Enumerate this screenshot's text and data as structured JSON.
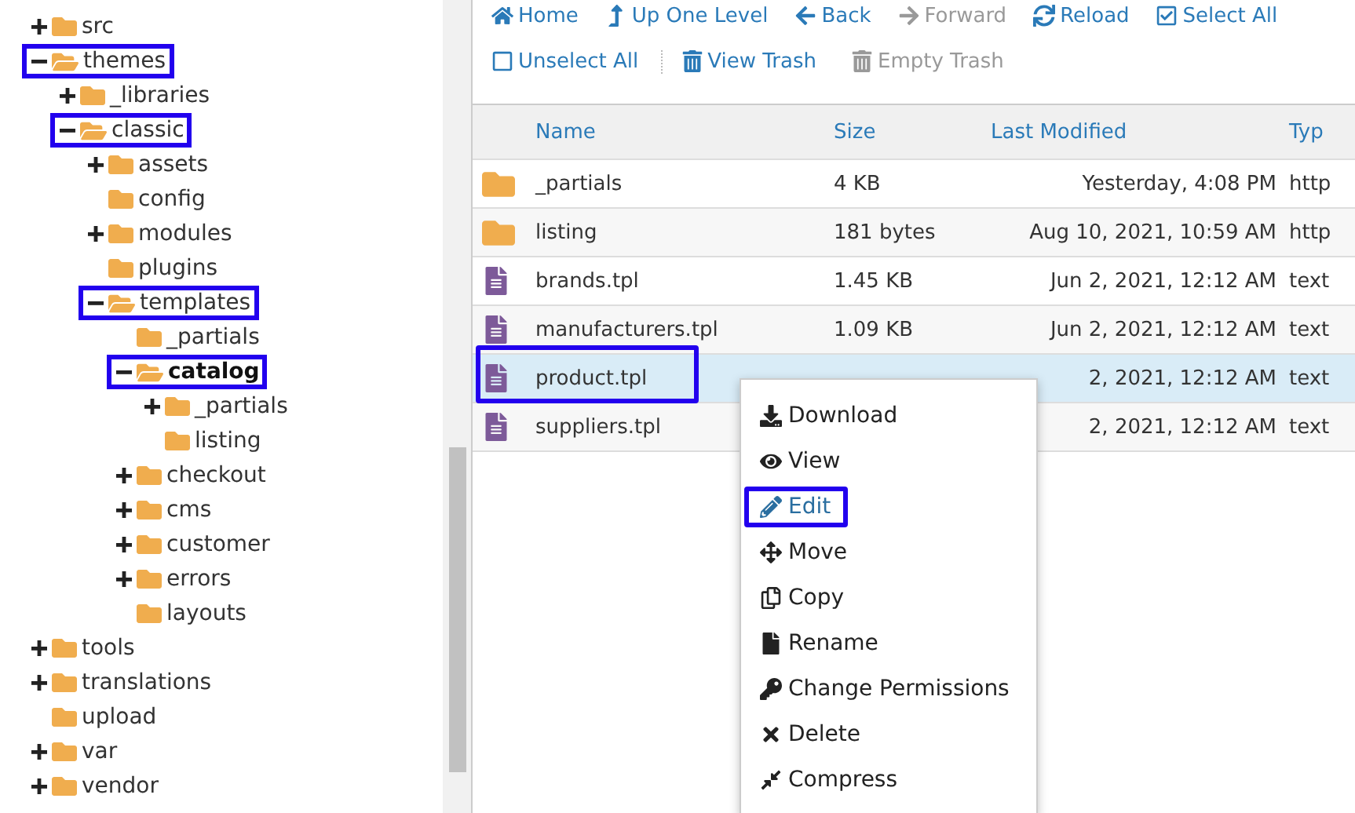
{
  "tree": [
    {
      "label": "src",
      "expanded": false,
      "has_children": true,
      "highlighted": false,
      "selected": false
    },
    {
      "label": "themes",
      "expanded": true,
      "has_children": true,
      "highlighted": true,
      "selected": false,
      "children": [
        {
          "label": "_libraries",
          "expanded": false,
          "has_children": true,
          "highlighted": false,
          "selected": false
        },
        {
          "label": "classic",
          "expanded": true,
          "has_children": true,
          "highlighted": true,
          "selected": false,
          "children": [
            {
              "label": "assets",
              "expanded": false,
              "has_children": true,
              "highlighted": false,
              "selected": false
            },
            {
              "label": "config",
              "expanded": false,
              "has_children": false,
              "highlighted": false,
              "selected": false
            },
            {
              "label": "modules",
              "expanded": false,
              "has_children": true,
              "highlighted": false,
              "selected": false
            },
            {
              "label": "plugins",
              "expanded": false,
              "has_children": false,
              "highlighted": false,
              "selected": false
            },
            {
              "label": "templates",
              "expanded": true,
              "has_children": true,
              "highlighted": true,
              "selected": false,
              "children": [
                {
                  "label": "_partials",
                  "expanded": false,
                  "has_children": false,
                  "highlighted": false,
                  "selected": false
                },
                {
                  "label": "catalog",
                  "expanded": true,
                  "has_children": true,
                  "highlighted": true,
                  "selected": true,
                  "children": [
                    {
                      "label": "_partials",
                      "expanded": false,
                      "has_children": true,
                      "highlighted": false,
                      "selected": false
                    },
                    {
                      "label": "listing",
                      "expanded": false,
                      "has_children": false,
                      "highlighted": false,
                      "selected": false
                    }
                  ]
                },
                {
                  "label": "checkout",
                  "expanded": false,
                  "has_children": true,
                  "highlighted": false,
                  "selected": false
                },
                {
                  "label": "cms",
                  "expanded": false,
                  "has_children": true,
                  "highlighted": false,
                  "selected": false
                },
                {
                  "label": "customer",
                  "expanded": false,
                  "has_children": true,
                  "highlighted": false,
                  "selected": false
                },
                {
                  "label": "errors",
                  "expanded": false,
                  "has_children": true,
                  "highlighted": false,
                  "selected": false
                },
                {
                  "label": "layouts",
                  "expanded": false,
                  "has_children": false,
                  "highlighted": false,
                  "selected": false
                }
              ]
            }
          ]
        }
      ]
    },
    {
      "label": "tools",
      "expanded": false,
      "has_children": true,
      "highlighted": false,
      "selected": false
    },
    {
      "label": "translations",
      "expanded": false,
      "has_children": true,
      "highlighted": false,
      "selected": false
    },
    {
      "label": "upload",
      "expanded": false,
      "has_children": false,
      "highlighted": false,
      "selected": false
    },
    {
      "label": "var",
      "expanded": false,
      "has_children": true,
      "highlighted": false,
      "selected": false
    },
    {
      "label": "vendor",
      "expanded": false,
      "has_children": true,
      "highlighted": false,
      "selected": false
    }
  ],
  "toolbar": [
    [
      {
        "kind": "home",
        "label": "Home",
        "disabled": false
      },
      {
        "kind": "up",
        "label": "Up One Level",
        "disabled": false
      },
      {
        "kind": "back",
        "label": "Back",
        "disabled": false
      },
      {
        "kind": "forward",
        "label": "Forward",
        "disabled": true
      },
      {
        "kind": "reload",
        "label": "Reload",
        "disabled": false
      },
      {
        "kind": "select",
        "label": "Select All",
        "disabled": false
      }
    ],
    [
      {
        "kind": "unselect",
        "label": "Unselect All",
        "disabled": false
      },
      {
        "kind": "trash",
        "label": "View Trash",
        "disabled": false
      },
      {
        "kind": "trash",
        "label": "Empty Trash",
        "disabled": true
      }
    ]
  ],
  "table": {
    "columns": [
      "Name",
      "Size",
      "Last Modified",
      "Typ"
    ],
    "rows": [
      {
        "kind": "folder",
        "name": "_partials",
        "size": "4 KB",
        "modified": "Yesterday, 4:08 PM",
        "type": "http",
        "selected": false,
        "highlighted": false
      },
      {
        "kind": "folder",
        "name": "listing",
        "size": "181 bytes",
        "modified": "Aug 10, 2021, 10:59 AM",
        "type": "http",
        "selected": false,
        "highlighted": false
      },
      {
        "kind": "file",
        "name": "brands.tpl",
        "size": "1.45 KB",
        "modified": "Jun 2, 2021, 12:12 AM",
        "type": "text",
        "selected": false,
        "highlighted": false
      },
      {
        "kind": "file",
        "name": "manufacturers.tpl",
        "size": "1.09 KB",
        "modified": "Jun 2, 2021, 12:12 AM",
        "type": "text",
        "selected": false,
        "highlighted": false
      },
      {
        "kind": "file",
        "name": "product.tpl",
        "modified": "2, 2021, 12:12 AM",
        "type": "text",
        "selected": true,
        "highlighted": true
      },
      {
        "kind": "file",
        "name": "suppliers.tpl",
        "modified": "2, 2021, 12:12 AM",
        "type": "text",
        "selected": false,
        "highlighted": false
      }
    ]
  },
  "context_menu": [
    {
      "kind": "download",
      "label": "Download",
      "highlighted": false
    },
    {
      "kind": "view",
      "label": "View",
      "highlighted": false
    },
    {
      "kind": "edit",
      "label": "Edit",
      "highlighted": true
    },
    {
      "kind": "move",
      "label": "Move",
      "highlighted": false
    },
    {
      "kind": "copy",
      "label": "Copy",
      "highlighted": false
    },
    {
      "kind": "rename",
      "label": "Rename",
      "highlighted": false
    },
    {
      "kind": "permissions",
      "label": "Change Permissions",
      "highlighted": false
    },
    {
      "kind": "delete",
      "label": "Delete",
      "highlighted": false
    },
    {
      "kind": "compress",
      "label": "Compress",
      "highlighted": false
    }
  ]
}
